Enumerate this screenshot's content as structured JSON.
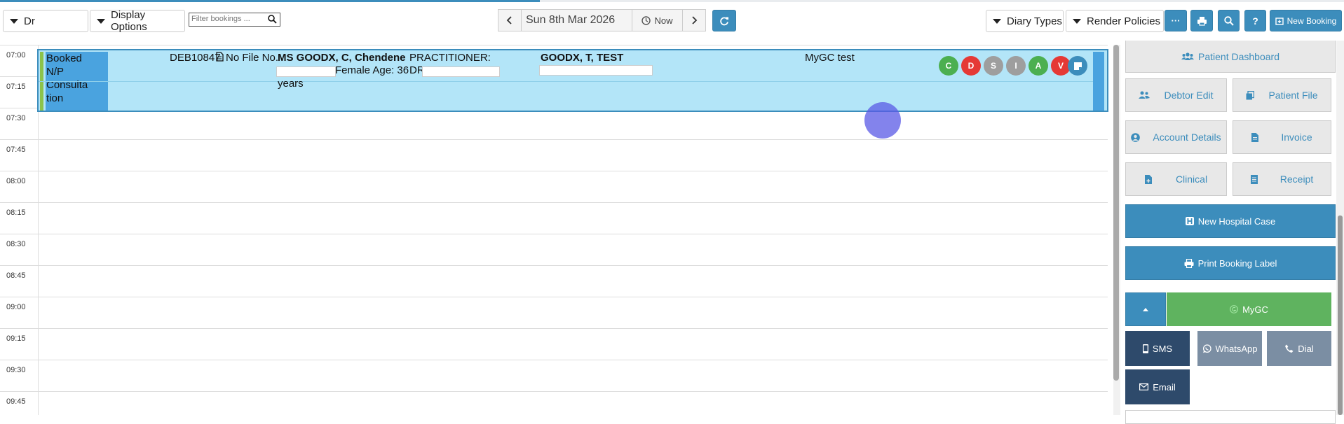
{
  "toolbar": {
    "doctor_select": "Dr",
    "display_options": "Display Options",
    "filter_placeholder": "Filter bookings ...",
    "date": "Sun 8th Mar 2026",
    "now": "Now",
    "diary_types": "Diary Types",
    "render_policies": "Render Policies",
    "more": "···",
    "help": "?",
    "new_booking": "New Booking"
  },
  "times": [
    "07:00",
    "07:15",
    "07:30",
    "07:45",
    "08:00",
    "08:15",
    "08:30",
    "08:45",
    "09:00",
    "09:15",
    "09:30",
    "09:45"
  ],
  "booking": {
    "status_line1": "Booked",
    "status_line2": "N/P Consulta",
    "status_line3": "tion",
    "debtor": "DEB10847",
    "file_no": "No File No.",
    "patient": "MS GOODX, C, Chendene",
    "gender_age": "Female Age: 36",
    "years": "years",
    "practitioner_label": "PRACTITIONER:",
    "dr": "DR",
    "practitioner_name": "GOODX, T, TEST",
    "note": "MyGC test",
    "indicators": [
      {
        "letter": "C",
        "color": "#4caf50"
      },
      {
        "letter": "D",
        "color": "#e53935"
      },
      {
        "letter": "S",
        "color": "#9e9e9e"
      },
      {
        "letter": "I",
        "color": "#9e9e9e"
      },
      {
        "letter": "A",
        "color": "#4caf50"
      },
      {
        "letter": "V",
        "color": "#e53935"
      }
    ]
  },
  "panel": {
    "patient_dashboard": "Patient Dashboard",
    "debtor_edit": "Debtor Edit",
    "patient_file": "Patient File",
    "account_details": "Account Details",
    "invoice": "Invoice",
    "clinical": "Clinical",
    "receipt": "Receipt",
    "new_hospital_case": "New Hospital Case",
    "print_booking_label": "Print Booking Label",
    "mygc": "MyGC",
    "sms": "SMS",
    "whatsapp": "WhatsApp",
    "dial": "Dial",
    "email": "Email"
  }
}
